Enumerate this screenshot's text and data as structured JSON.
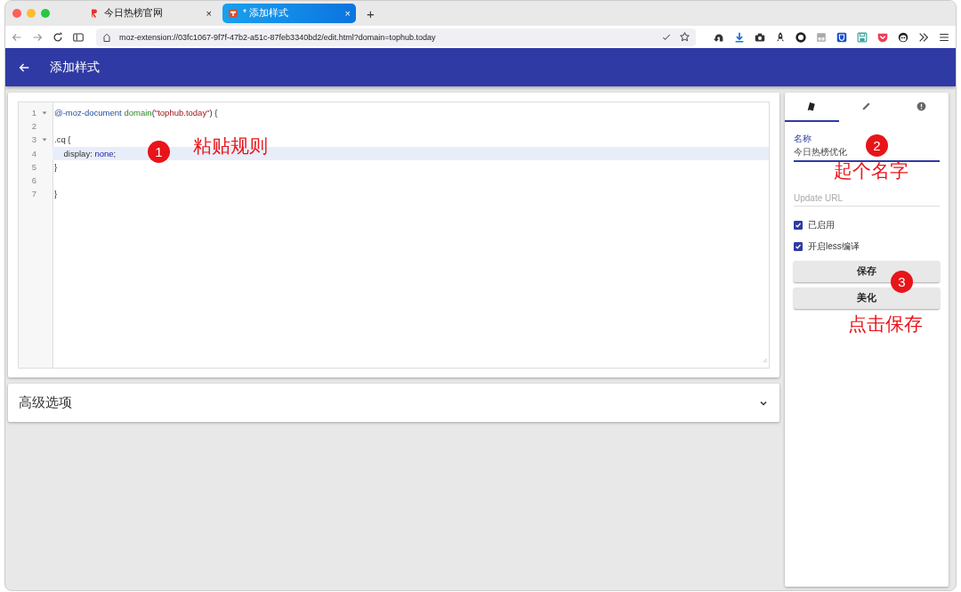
{
  "browser": {
    "tabs": [
      {
        "title": "今日热榜官网",
        "close": "×",
        "selected": false
      },
      {
        "title": "* 添加样式",
        "close": "×",
        "selected": true
      }
    ],
    "new_tab": "+",
    "url": "moz-extension://03fc1067-9f7f-47b2-a51c-87feb3340bd2/edit.html?domain=tophub.today"
  },
  "app_bar": {
    "title": "添加样式"
  },
  "editor": {
    "lines": [
      {
        "number": "1",
        "foldable": true,
        "active": false,
        "tokens": [
          {
            "kind": "keyword",
            "text": "@-moz-document"
          },
          {
            "kind": "function",
            "text": "domain"
          },
          {
            "kind": "plain",
            "text": "("
          },
          {
            "kind": "string",
            "text": "\"tophub.today\""
          },
          {
            "kind": "plain",
            "text": ") {"
          }
        ]
      },
      {
        "number": "2",
        "foldable": false,
        "active": false
      },
      {
        "number": "3",
        "foldable": true,
        "active": false,
        "tokens": [
          {
            "kind": "plain",
            "text": ".cq {"
          }
        ]
      },
      {
        "number": "4",
        "foldable": false,
        "active": true,
        "tokens": [
          {
            "kind": "plain",
            "text": "    display: "
          },
          {
            "kind": "value",
            "text": "none"
          },
          {
            "kind": "plain",
            "text": ";"
          }
        ]
      },
      {
        "number": "5",
        "foldable": false,
        "active": false,
        "tokens": [
          {
            "kind": "plain",
            "text": "}"
          }
        ]
      },
      {
        "number": "6",
        "foldable": false,
        "active": false
      },
      {
        "number": "7",
        "foldable": false,
        "active": false,
        "tokens": [
          {
            "kind": "plain",
            "text": "}"
          }
        ]
      }
    ]
  },
  "advanced": {
    "title": "高级选项",
    "expanded": false
  },
  "sidebar": {
    "tabs": [
      {
        "kind": "styles",
        "selected": true
      },
      {
        "kind": "edit",
        "selected": false
      },
      {
        "kind": "info",
        "selected": false
      }
    ],
    "name_field": {
      "label": "名称",
      "value": "今日热榜优化"
    },
    "url_field": {
      "placeholder": "Update URL"
    },
    "checkboxes": [
      {
        "label": "已启用",
        "checked": true
      },
      {
        "label": "开启less编译",
        "checked": true
      }
    ],
    "buttons": [
      "保存",
      "美化"
    ]
  },
  "annotations": [
    {
      "number": "1",
      "text": "粘贴规则"
    },
    {
      "number": "2",
      "text": "起个名字"
    },
    {
      "number": "3",
      "text": "点击保存"
    }
  ]
}
